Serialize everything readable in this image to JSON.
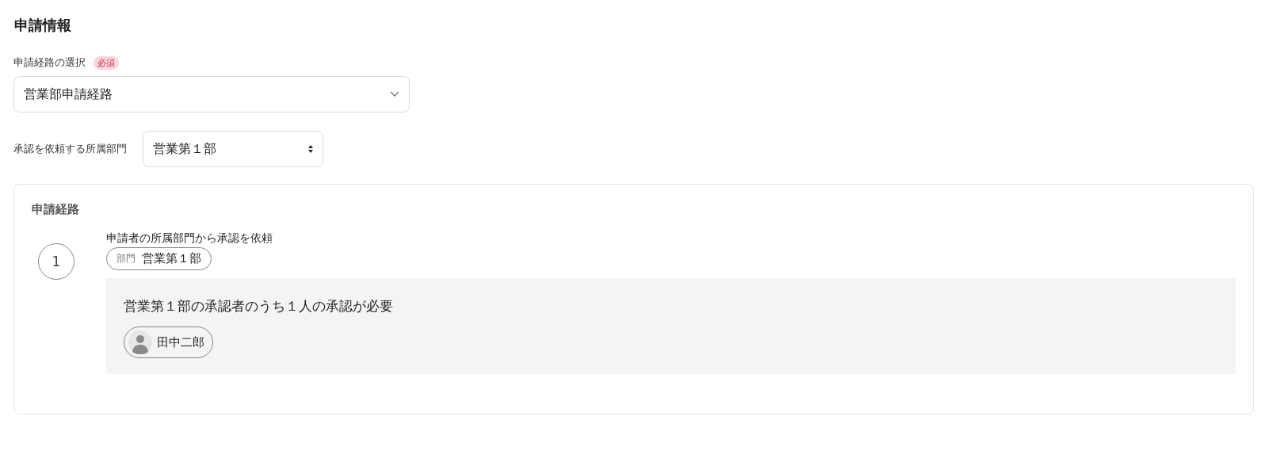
{
  "section_title": "申請情報",
  "route_select": {
    "label": "申請経路の選択",
    "required_badge": "必須",
    "value": "営業部申請経路"
  },
  "department_select": {
    "label": "承認を依頼する所属部門",
    "value": "営業第１部"
  },
  "route_card": {
    "title": "申請経路",
    "steps": [
      {
        "number": "1",
        "description": "申請者の所属部門から承認を依頼",
        "chip_label": "部門",
        "chip_value": "営業第１部",
        "approval_rule": "営業第１部の承認者のうち１人の承認が必要",
        "approvers": [
          {
            "name": "田中二郎"
          }
        ]
      }
    ]
  }
}
